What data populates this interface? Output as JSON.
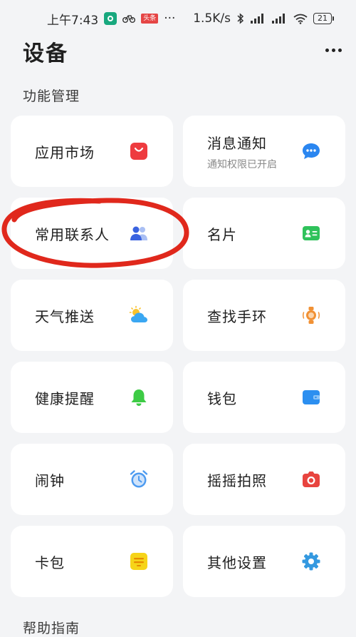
{
  "status_bar": {
    "time": "上午7:43",
    "news_badge": "头条",
    "dots": "···",
    "speed": "1.5K/s",
    "battery": "21"
  },
  "header": {
    "title": "设备"
  },
  "sections": {
    "feature_management": "功能管理",
    "help_guide": "帮助指南"
  },
  "cards": {
    "app_market": {
      "label": "应用市场"
    },
    "notifications": {
      "label": "消息通知",
      "sub": "通知权限已开启"
    },
    "contacts": {
      "label": "常用联系人"
    },
    "business_card": {
      "label": "名片"
    },
    "weather_push": {
      "label": "天气推送"
    },
    "find_band": {
      "label": "查找手环"
    },
    "health_reminder": {
      "label": "健康提醒"
    },
    "wallet": {
      "label": "钱包"
    },
    "alarm": {
      "label": "闹钟"
    },
    "shake_photo": {
      "label": "摇摇拍照"
    },
    "card_pack": {
      "label": "卡包"
    },
    "other_settings": {
      "label": "其他设置"
    }
  },
  "colors": {
    "background": "#f3f4f6",
    "card": "#ffffff",
    "market_red": "#ee3b3f",
    "notify_blue": "#2a86f0",
    "contacts_blue": "#3a63e0",
    "card_green": "#2fc25b",
    "weather_blue": "#3aa7f2",
    "weather_sun": "#f8c22c",
    "band_orange": "#f19134",
    "bell_green": "#3dcb45",
    "wallet_blue": "#2c8ff0",
    "alarm_blue": "#4d9bf0",
    "camera_red": "#e8443f",
    "cardpack_yellow": "#f6d419",
    "gear_blue": "#3499e0",
    "annotation_red": "#e0281c"
  }
}
